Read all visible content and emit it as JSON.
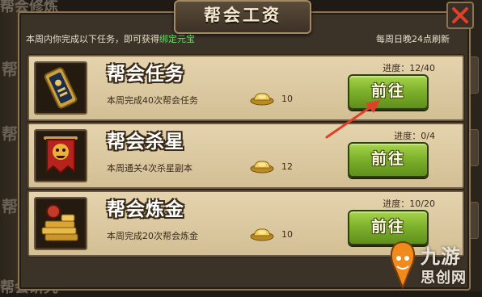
{
  "background": {
    "top_text": "帮会修炼",
    "bottom_text": "帮会研究",
    "left_fragments": [
      "帮",
      "帮",
      "帮"
    ]
  },
  "dialog": {
    "title": "帮会工资",
    "intro_prefix": "本周内你完成以下任务，即可获得",
    "intro_highlight": "绑定元宝",
    "refresh_note": "每周日晚24点刷新",
    "close_icon": "close-x-icon"
  },
  "tasks": [
    {
      "name": "帮会任务",
      "description": "本周完成40次帮会任务",
      "reward_icon": "gold-ingot-icon",
      "reward": "10",
      "progress": "进度：12/40",
      "button": "前往"
    },
    {
      "name": "帮会杀星",
      "description": "本周通关4次杀星副本",
      "reward_icon": "gold-ingot-icon",
      "reward": "12",
      "progress": "进度：0/4",
      "button": "前往"
    },
    {
      "name": "帮会炼金",
      "description": "本周完成20次帮会炼金",
      "reward_icon": "gold-ingot-icon",
      "reward": "10",
      "progress": "进度：10/20",
      "button": "前往"
    }
  ],
  "watermark": {
    "line1": "九游",
    "line2": "思创网"
  },
  "colors": {
    "highlight": "#5ee05a",
    "button_green": "#7fb22c",
    "annotation_red": "#e0402a"
  }
}
